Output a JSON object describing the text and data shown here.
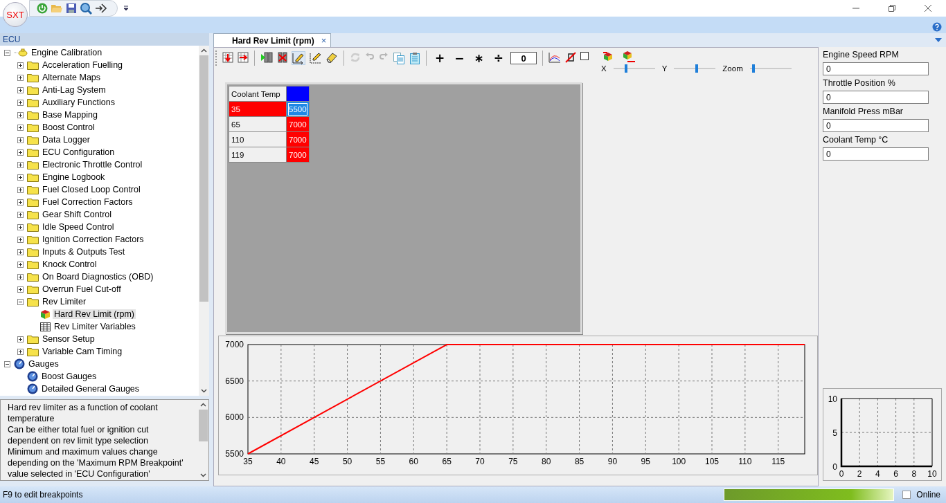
{
  "app": {
    "logo": "SXT"
  },
  "tree_header": "ECU",
  "tree": [
    {
      "label": "Engine Calibration",
      "kind": "engine",
      "expanded": true,
      "selected": false,
      "children": [
        {
          "label": "Acceleration Fuelling",
          "kind": "folder",
          "expanded": false,
          "selected": false
        },
        {
          "label": "Alternate Maps",
          "kind": "folder",
          "expanded": false,
          "selected": false
        },
        {
          "label": "Anti-Lag System",
          "kind": "folder",
          "expanded": false,
          "selected": false
        },
        {
          "label": "Auxiliary Functions",
          "kind": "folder",
          "expanded": false,
          "selected": false
        },
        {
          "label": "Base Mapping",
          "kind": "folder",
          "expanded": false,
          "selected": false
        },
        {
          "label": "Boost Control",
          "kind": "folder",
          "expanded": false,
          "selected": false
        },
        {
          "label": "Data Logger",
          "kind": "folder",
          "expanded": false,
          "selected": false
        },
        {
          "label": "ECU Configuration",
          "kind": "folder",
          "expanded": false,
          "selected": false
        },
        {
          "label": "Electronic Throttle Control",
          "kind": "folder",
          "expanded": false,
          "selected": false
        },
        {
          "label": "Engine Logbook",
          "kind": "folder",
          "expanded": false,
          "selected": false
        },
        {
          "label": "Fuel Closed Loop Control",
          "kind": "folder",
          "expanded": false,
          "selected": false
        },
        {
          "label": "Fuel Correction Factors",
          "kind": "folder",
          "expanded": false,
          "selected": false
        },
        {
          "label": "Gear Shift Control",
          "kind": "folder",
          "expanded": false,
          "selected": false
        },
        {
          "label": "Idle Speed Control",
          "kind": "folder",
          "expanded": false,
          "selected": false
        },
        {
          "label": "Ignition Correction Factors",
          "kind": "folder",
          "expanded": false,
          "selected": false
        },
        {
          "label": "Inputs & Outputs Test",
          "kind": "folder",
          "expanded": false,
          "selected": false
        },
        {
          "label": "Knock Control",
          "kind": "folder",
          "expanded": false,
          "selected": false
        },
        {
          "label": "On Board Diagnostics (OBD)",
          "kind": "folder",
          "expanded": false,
          "selected": false
        },
        {
          "label": "Overrun Fuel Cut-off",
          "kind": "folder",
          "expanded": false,
          "selected": false
        },
        {
          "label": "Rev Limiter",
          "kind": "folder",
          "expanded": true,
          "selected": false,
          "children": [
            {
              "label": "Hard Rev Limit (rpm)",
              "kind": "map",
              "selected": true
            },
            {
              "label": "Rev Limiter Variables",
              "kind": "table",
              "selected": false
            }
          ]
        },
        {
          "label": "Sensor Setup",
          "kind": "folder",
          "expanded": false,
          "selected": false
        },
        {
          "label": "Variable Cam Timing",
          "kind": "folder",
          "expanded": false,
          "selected": false
        }
      ]
    },
    {
      "label": "Gauges",
      "kind": "gauge",
      "expanded": true,
      "selected": false,
      "children": [
        {
          "label": "Boost Gauges",
          "kind": "gauge",
          "selected": false
        },
        {
          "label": "Detailed General Gauges",
          "kind": "gauge",
          "selected": false
        }
      ]
    }
  ],
  "description": "Hard rev limiter as a function of coolant\ntemperature\nCan be either total fuel or ignition cut\ndependent on rev limit type selection\nMinimum and maximum values change\ndepending on the 'Maximum RPM Breakpoint'\nvalue selected in 'ECU Configuration'",
  "tabs": [
    {
      "label": "Hard Rev Limit (rpm)",
      "selected": true,
      "close": "×"
    }
  ],
  "toolbar": {
    "tools": [
      {
        "disabled": false
      },
      {
        "disabled": false
      },
      {
        "disabled": false
      },
      {
        "disabled": false
      },
      {
        "disabled": false
      },
      {
        "disabled": false
      },
      {
        "disabled": false
      },
      {
        "disabled": true
      },
      {
        "disabled": true
      },
      {
        "disabled": true
      },
      {
        "disabled": false
      },
      {
        "disabled": false
      }
    ],
    "operators": [
      "+",
      "−",
      "∗",
      "÷"
    ],
    "value": "0",
    "graph_checked": false
  },
  "sliders": [
    {
      "label": "X",
      "level": 0.3
    },
    {
      "label": "Y",
      "level": 0.55
    },
    {
      "label": "Zoom",
      "level": 0.08
    }
  ],
  "table": {
    "header": "Coolant Temp",
    "rows": [
      {
        "axis": "35",
        "value": "5500",
        "selected": true,
        "color": "#1e88e5"
      },
      {
        "axis": "65",
        "value": "7000",
        "selected": false,
        "color": "#ff0000"
      },
      {
        "axis": "110",
        "value": "7000",
        "selected": false,
        "color": "#ff0000"
      },
      {
        "axis": "119",
        "value": "7000",
        "selected": false,
        "color": "#ff0000"
      }
    ]
  },
  "chart": {
    "chart_data": {
      "type": "line",
      "x": [
        35,
        65,
        119
      ],
      "series": [
        {
          "color": "#ff0000",
          "values": [
            5500,
            7000,
            7000
          ]
        }
      ],
      "grid": true,
      "xlim": [
        35,
        119
      ],
      "ylim": [
        5500,
        7000
      ],
      "xticks": [
        35,
        40,
        45,
        50,
        55,
        60,
        65,
        70,
        75,
        80,
        85,
        90,
        95,
        100,
        105,
        110,
        115
      ],
      "yticks": [
        5500,
        6000,
        6500,
        7000
      ]
    }
  },
  "live_values": [
    {
      "label": "Engine Speed RPM",
      "value": "0"
    },
    {
      "label": "Throttle Position %",
      "value": "0"
    },
    {
      "label": "Manifold Press mBar",
      "value": "0"
    },
    {
      "label": "Coolant Temp °C",
      "value": "0"
    }
  ],
  "mini_chart": {
    "chart_data": {
      "type": "line",
      "grid": true,
      "xlim": [
        0,
        10
      ],
      "ylim": [
        0,
        10
      ],
      "xticks": [
        0,
        2,
        4,
        6,
        8,
        10
      ],
      "yticks": [
        0,
        5,
        10
      ]
    }
  },
  "status_bar": {
    "text": "F9 to edit breakpoints",
    "level": 1,
    "online_label": "Online",
    "online_checked": false
  }
}
